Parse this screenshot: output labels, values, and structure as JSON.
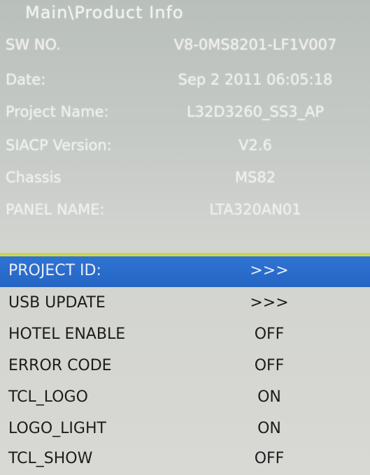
{
  "header": {
    "title": "Main\\Product Info"
  },
  "product_info": [
    {
      "label": "SW NO.",
      "value": "V8-0MS8201-LF1V007"
    },
    {
      "label": "Date:",
      "value": "Sep  2 2011 06:05:18"
    },
    {
      "label": "Project Name:",
      "value": "L32D3260_SS3_AP"
    },
    {
      "label": "SIACP Version:",
      "value": "V2.6"
    },
    {
      "label": "Chassis",
      "value": "MS82"
    },
    {
      "label": "PANEL NAME:",
      "value": "LTA320AN01"
    }
  ],
  "menu": [
    {
      "label": "PROJECT ID:",
      "value": ">>>",
      "selected": true
    },
    {
      "label": "USB UPDATE",
      "value": ">>>"
    },
    {
      "label": "HOTEL ENABLE",
      "value": "OFF"
    },
    {
      "label": "ERROR CODE",
      "value": "OFF"
    },
    {
      "label": "TCL_LOGO",
      "value": "ON"
    },
    {
      "label": "LOGO_LIGHT",
      "value": "ON"
    },
    {
      "label": "TCL_SHOW",
      "value": "OFF"
    }
  ],
  "colors": {
    "highlight": "#2f74d3",
    "divider": "#c9d24a",
    "info_text": "#eef0ee",
    "menu_text": "#1c1c1c"
  }
}
